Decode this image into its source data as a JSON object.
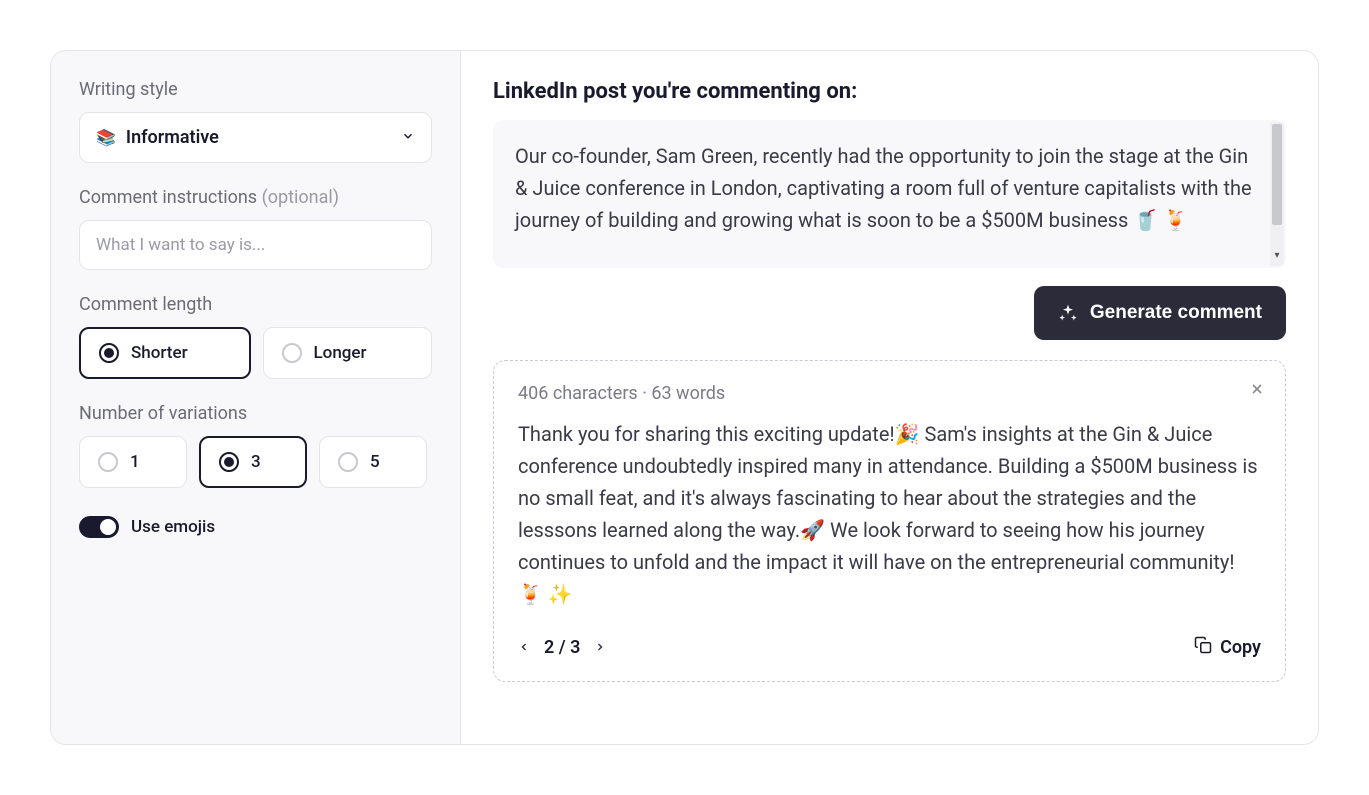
{
  "sidebar": {
    "writing_style_label": "Writing style",
    "writing_style_icon": "📚",
    "writing_style_value": "Informative",
    "comment_instructions_label": "Comment instructions ",
    "comment_instructions_optional": "(optional)",
    "comment_instructions_placeholder": "What I want to say is...",
    "comment_length_label": "Comment length",
    "length_options": {
      "shorter": "Shorter",
      "longer": "Longer"
    },
    "length_selected": "shorter",
    "variations_label": "Number of variations",
    "variation_options": {
      "one": "1",
      "three": "3",
      "five": "5"
    },
    "variations_selected": "three",
    "use_emojis_label": "Use emojis",
    "use_emojis_on": true
  },
  "main": {
    "heading": "LinkedIn post you're commenting on:",
    "post_text": "Our co-founder, Sam Green, recently had the opportunity to join the stage at the Gin & Juice conference in London, captivating a room full of venture capitalists with the journey of building and growing what is soon to be a $500M business 🥤 🍹",
    "generate_label": "Generate comment",
    "result": {
      "meta": "406 characters · 63 words",
      "text": "Thank you for sharing this exciting update!🎉 Sam's insights at the Gin & Juice conference undoubtedly inspired many in attendance. Building a $500M business is no small feat, and it's always fascinating to hear about the strategies and the lesssons learned along the way.🚀 We look forward to seeing how his journey continues to unfold and the impact it will have on the entrepreneurial community! 🍹 ✨",
      "page_current": "2",
      "page_total": "3",
      "copy_label": "Copy"
    }
  }
}
